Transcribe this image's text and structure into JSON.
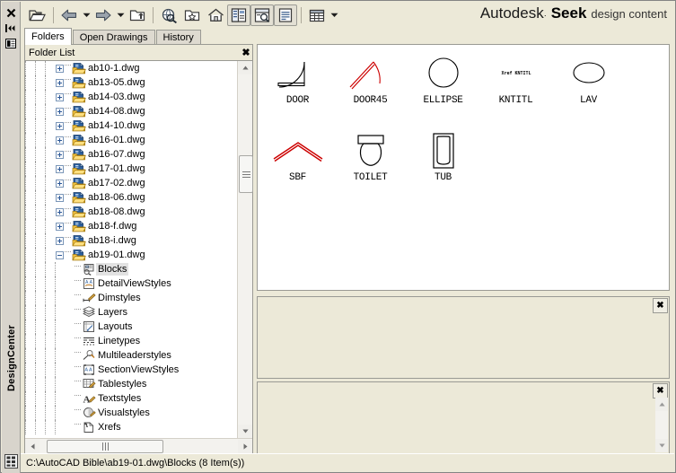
{
  "window": {
    "palette_title": "DesignCenter",
    "brand": {
      "autodesk": "Autodesk",
      "trademark": "·",
      "seek": "Seek",
      "tagline": "design content"
    }
  },
  "leftbar": {
    "close_label": "✖",
    "autohide_label": "◀▶",
    "properties_label": "▤"
  },
  "toolbar": {
    "buttons": [
      {
        "name": "load-button",
        "icon": "open-folder-icon",
        "pressed": false
      },
      {
        "name": "back-button",
        "icon": "arrow-left-icon",
        "pressed": false
      },
      {
        "name": "back-dropdown",
        "icon": "chevron-down-icon",
        "pressed": false
      },
      {
        "name": "forward-button",
        "icon": "arrow-right-icon",
        "pressed": false
      },
      {
        "name": "forward-dropdown",
        "icon": "chevron-down-icon",
        "pressed": false
      },
      {
        "name": "up-button",
        "icon": "folder-up-icon",
        "pressed": false
      },
      {
        "name": "search-button",
        "icon": "search-globe-icon",
        "pressed": false
      },
      {
        "name": "favorites-button",
        "icon": "favorites-star-icon",
        "pressed": false
      },
      {
        "name": "home-button",
        "icon": "home-icon",
        "pressed": false
      },
      {
        "name": "tree-view-toggle-button",
        "icon": "tree-view-icon",
        "pressed": true
      },
      {
        "name": "preview-toggle-button",
        "icon": "preview-icon",
        "pressed": true
      },
      {
        "name": "description-toggle-button",
        "icon": "description-icon",
        "pressed": true
      },
      {
        "name": "views-button",
        "icon": "views-list-icon",
        "pressed": false
      },
      {
        "name": "views-dropdown",
        "icon": "chevron-down-icon",
        "pressed": false
      }
    ]
  },
  "tabs": [
    {
      "label": "Folders",
      "active": true
    },
    {
      "label": "Open Drawings",
      "active": false
    },
    {
      "label": "History",
      "active": false
    }
  ],
  "tree": {
    "header": "Folder List",
    "close_label": "✖",
    "items": [
      {
        "label": "ab10-1.dwg",
        "icon": "dwg-icon",
        "indent": 4,
        "expander": "plus",
        "selected": false
      },
      {
        "label": "ab13-05.dwg",
        "icon": "dwg-icon",
        "indent": 4,
        "expander": "plus",
        "selected": false
      },
      {
        "label": "ab14-03.dwg",
        "icon": "dwg-icon",
        "indent": 4,
        "expander": "plus",
        "selected": false
      },
      {
        "label": "ab14-08.dwg",
        "icon": "dwg-icon",
        "indent": 4,
        "expander": "plus",
        "selected": false
      },
      {
        "label": "ab14-10.dwg",
        "icon": "dwg-icon",
        "indent": 4,
        "expander": "plus",
        "selected": false
      },
      {
        "label": "ab16-01.dwg",
        "icon": "dwg-icon",
        "indent": 4,
        "expander": "plus",
        "selected": false
      },
      {
        "label": "ab16-07.dwg",
        "icon": "dwg-icon",
        "indent": 4,
        "expander": "plus",
        "selected": false
      },
      {
        "label": "ab17-01.dwg",
        "icon": "dwg-icon",
        "indent": 4,
        "expander": "plus",
        "selected": false
      },
      {
        "label": "ab17-02.dwg",
        "icon": "dwg-icon",
        "indent": 4,
        "expander": "plus",
        "selected": false
      },
      {
        "label": "ab18-06.dwg",
        "icon": "dwg-icon",
        "indent": 4,
        "expander": "plus",
        "selected": false
      },
      {
        "label": "ab18-08.dwg",
        "icon": "dwg-icon",
        "indent": 4,
        "expander": "plus",
        "selected": false
      },
      {
        "label": "ab18-f.dwg",
        "icon": "dwg-icon",
        "indent": 4,
        "expander": "plus",
        "selected": false
      },
      {
        "label": "ab18-i.dwg",
        "icon": "dwg-icon",
        "indent": 4,
        "expander": "plus",
        "selected": false
      },
      {
        "label": "ab19-01.dwg",
        "icon": "dwg-icon",
        "indent": 4,
        "expander": "minus",
        "selected": false
      },
      {
        "label": "Blocks",
        "icon": "blocks-icon",
        "indent": 5,
        "expander": "none",
        "selected": true
      },
      {
        "label": "DetailViewStyles",
        "icon": "detailview-icon",
        "indent": 5,
        "expander": "none",
        "selected": false
      },
      {
        "label": "Dimstyles",
        "icon": "dimstyle-icon",
        "indent": 5,
        "expander": "none",
        "selected": false
      },
      {
        "label": "Layers",
        "icon": "layers-icon",
        "indent": 5,
        "expander": "none",
        "selected": false
      },
      {
        "label": "Layouts",
        "icon": "layouts-icon",
        "indent": 5,
        "expander": "none",
        "selected": false
      },
      {
        "label": "Linetypes",
        "icon": "linetypes-icon",
        "indent": 5,
        "expander": "none",
        "selected": false
      },
      {
        "label": "Multileaderstyles",
        "icon": "multileader-icon",
        "indent": 5,
        "expander": "none",
        "selected": false
      },
      {
        "label": "SectionViewStyles",
        "icon": "sectionview-icon",
        "indent": 5,
        "expander": "none",
        "selected": false
      },
      {
        "label": "Tablestyles",
        "icon": "tablestyle-icon",
        "indent": 5,
        "expander": "none",
        "selected": false
      },
      {
        "label": "Textstyles",
        "icon": "textstyle-icon",
        "indent": 5,
        "expander": "none",
        "selected": false
      },
      {
        "label": "Visualstyles",
        "icon": "visualstyle-icon",
        "indent": 5,
        "expander": "none",
        "selected": false
      },
      {
        "label": "Xrefs",
        "icon": "xrefs-icon",
        "indent": 5,
        "expander": "none",
        "selected": false
      }
    ]
  },
  "content": {
    "blocks": [
      {
        "label": "DOOR",
        "preview": "door",
        "color": "#000000"
      },
      {
        "label": "DOOR45",
        "preview": "door45",
        "color": "#cc0000"
      },
      {
        "label": "ELLIPSE",
        "preview": "ellipse",
        "color": "#000000"
      },
      {
        "label": "KNTITL",
        "preview": "kntitl",
        "color": "#000000",
        "preview_text": "Xref KNTITL"
      },
      {
        "label": "LAV",
        "preview": "lav",
        "color": "#000000"
      },
      {
        "label": "SBF",
        "preview": "sbf",
        "color": "#cc0000"
      },
      {
        "label": "TOILET",
        "preview": "toilet",
        "color": "#000000"
      },
      {
        "label": "TUB",
        "preview": "tub",
        "color": "#000000"
      }
    ]
  },
  "preview_pane": {
    "close_label": "✖",
    "content": ""
  },
  "description_pane": {
    "close_label": "✖",
    "content": ""
  },
  "statusbar": {
    "path": "C:\\AutoCAD Bible\\ab19-01.dwg\\Blocks (8 Item(s))"
  }
}
